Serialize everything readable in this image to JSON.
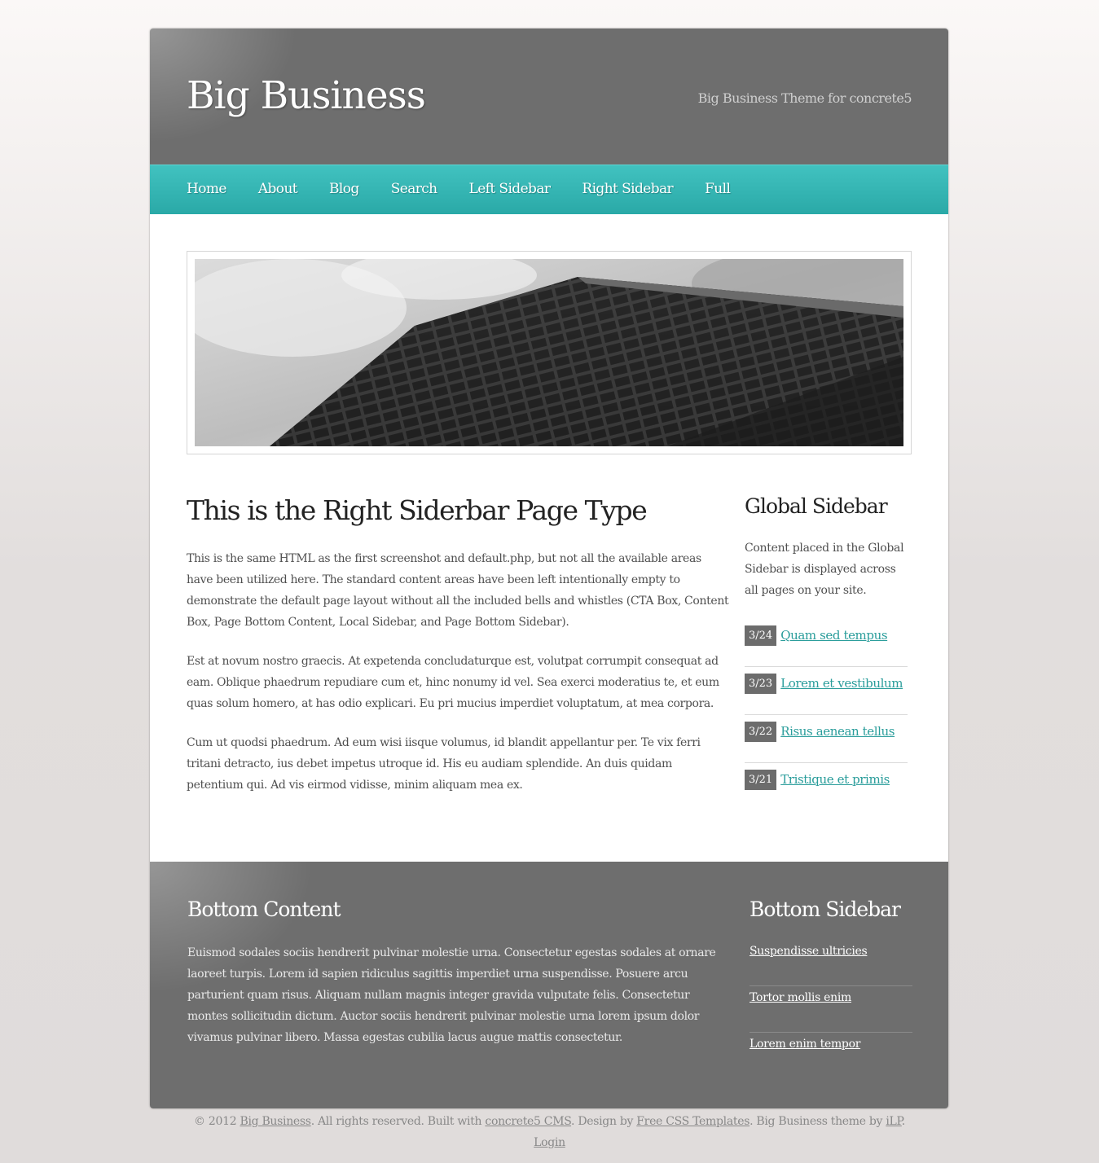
{
  "header": {
    "site_title": "Big Business",
    "tagline": "Big Business Theme for concrete5"
  },
  "nav": {
    "items": [
      "Home",
      "About",
      "Blog",
      "Search",
      "Left Sidebar",
      "Right Sidebar",
      "Full"
    ]
  },
  "main": {
    "title": "This is the Right Siderbar Page Type",
    "paragraphs": [
      "This is the same HTML as the first screenshot and default.php, but not all the available areas have been utilized here. The standard content areas have been left intentionally empty to demonstrate the default page layout without all the included bells and whistles (CTA Box, Content Box, Page Bottom Content, Local Sidebar, and Page Bottom Sidebar).",
      "Est at novum nostro graecis. At expetenda concludaturque est, volutpat corrumpit consequat ad eam. Oblique phaedrum repudiare cum et, hinc nonumy id vel. Sea exerci moderatius te, et eum quas solum homero, at has odio explicari. Eu pri mucius imperdiet voluptatum, at mea corpora.",
      "Cum ut quodsi phaedrum. Ad eum wisi iisque volumus, id blandit appellantur per. Te vix ferri tritani detracto, ius debet impetus utroque id. His eu audiam splendide. An duis quidam petentium qui. Ad vis eirmod vidisse, minim aliquam mea ex."
    ]
  },
  "sidebar": {
    "title": "Global Sidebar",
    "description": "Content placed in the Global Sidebar is displayed across all pages on your site.",
    "items": [
      {
        "date": "3/24",
        "label": "Quam sed tempus"
      },
      {
        "date": "3/23",
        "label": "Lorem et vestibulum"
      },
      {
        "date": "3/22",
        "label": "Risus aenean tellus"
      },
      {
        "date": "3/21",
        "label": "Tristique et primis"
      }
    ]
  },
  "bottom": {
    "content_title": "Bottom Content",
    "content_body": "Euismod sodales sociis hendrerit pulvinar molestie urna. Consectetur egestas sodales at ornare laoreet turpis. Lorem id sapien ridiculus sagittis imperdiet urna suspendisse. Posuere arcu parturient quam risus. Aliquam nullam magnis integer gravida vulputate felis. Consectetur montes sollicitudin dictum. Auctor sociis hendrerit pulvinar molestie urna lorem ipsum dolor vivamus pulvinar libero. Massa egestas cubilia lacus augue mattis consectetur.",
    "sidebar_title": "Bottom Sidebar",
    "links": [
      "Suspendisse ultricies",
      "Tortor mollis enim",
      "Lorem enim tempor"
    ]
  },
  "footer": {
    "prefix": "© 2012 ",
    "site_link": "Big Business",
    "text1": ". All rights reserved. Built with ",
    "cms_link": "concrete5 CMS",
    "text2": ". Design by ",
    "design_link": "Free CSS Templates",
    "text3": ". Big Business theme by ",
    "author_link": "iLP",
    "text4": ".",
    "login_link": "Login"
  },
  "colors": {
    "nav_accent": "#35b6b4",
    "header_gray": "#6e6e6e",
    "link_teal": "#2a9d9b"
  }
}
